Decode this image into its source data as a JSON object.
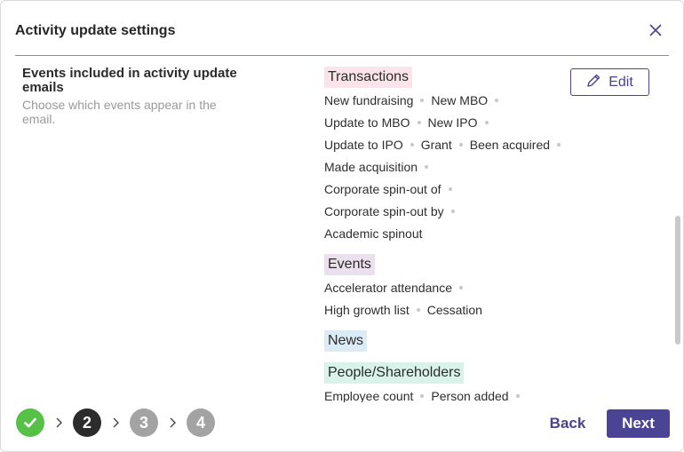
{
  "dialog": {
    "title": "Activity update settings"
  },
  "section": {
    "title": "Events included in activity update emails",
    "description": "Choose which events appear in the email.",
    "edit_label": "Edit"
  },
  "groups": [
    {
      "name": "Transactions",
      "color": "#fbe3ea",
      "lines": [
        [
          "New fundraising",
          "New MBO"
        ],
        [
          "Update to MBO",
          "New IPO"
        ],
        [
          "Update to IPO",
          "Grant",
          "Been acquired"
        ],
        [
          "Made acquisition"
        ],
        [
          "Corporate spin-out of"
        ],
        [
          "Corporate spin-out by"
        ],
        [
          "Academic spinout"
        ]
      ]
    },
    {
      "name": "Events",
      "color": "#ebe0ed",
      "lines": [
        [
          "Accelerator attendance"
        ],
        [
          "High growth list",
          "Cessation"
        ]
      ]
    },
    {
      "name": "News",
      "color": "#dcecf6",
      "lines": []
    },
    {
      "name": "People/Shareholders",
      "color": "#d9f3ea",
      "lines": [
        [
          "Employee count",
          "Person added"
        ]
      ]
    }
  ],
  "stepper": {
    "steps": [
      "1",
      "2",
      "3",
      "4"
    ],
    "current": 2
  },
  "footer": {
    "back_label": "Back",
    "next_label": "Next"
  },
  "colors": {
    "accent": "#4b4494",
    "done": "#57c147"
  }
}
